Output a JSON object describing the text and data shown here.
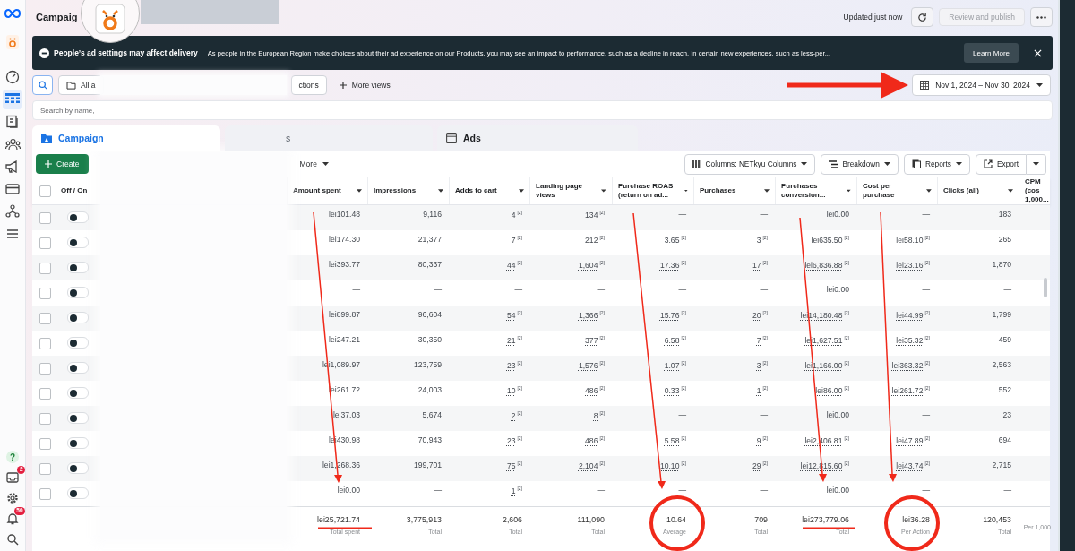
{
  "rail": {
    "items": [
      {
        "kind": "gauge",
        "selected": false
      },
      {
        "kind": "table",
        "selected": true
      },
      {
        "kind": "document",
        "selected": false
      },
      {
        "kind": "people",
        "selected": false
      },
      {
        "kind": "megaphone",
        "selected": false
      },
      {
        "kind": "card",
        "selected": false
      },
      {
        "kind": "network",
        "selected": false
      },
      {
        "kind": "menu",
        "selected": false
      }
    ],
    "bottom": [
      {
        "kind": "help",
        "glyph": "?"
      },
      {
        "kind": "inbox",
        "badge": "2"
      },
      {
        "kind": "gear"
      },
      {
        "kind": "bell",
        "badge": "50"
      },
      {
        "kind": "search"
      }
    ]
  },
  "header": {
    "title": "Campaig",
    "updated": "Updated just now",
    "publish": {
      "label": "Review and publish",
      "disabled": true
    }
  },
  "banner": {
    "title": "People’s ad settings may affect delivery",
    "text": "As people in the European Region make choices about their ad experience on our Products, you may see an impact to performance, such as a decline in reach. In certain new experiences, such as less-per...",
    "button": "Learn More"
  },
  "toolbar": {
    "folder": "All a",
    "collections": "ctions",
    "more_views": "More views",
    "date_range": "Nov 1, 2024 – Nov 30, 2024"
  },
  "search": {
    "placeholder": "Search by name,"
  },
  "tabs": [
    {
      "label": "Campaign",
      "selected": true
    },
    {
      "label": "s",
      "selected": false
    },
    {
      "label": "Ads",
      "selected": false
    }
  ],
  "actions": {
    "create": "Create",
    "more": "More",
    "columns": "Columns: NETkyu Columns",
    "breakdown": "Breakdown",
    "reports": "Reports",
    "export": "Export"
  },
  "table": {
    "all_checked": false,
    "onoff": "Off / On",
    "columns": [
      "Amount spent",
      "Impressions",
      "Adds to cart",
      "Landing page views",
      "Purchase ROAS (return on ad...",
      "Purchases",
      "Purchases conversion...",
      "Cost per purchase",
      "Clicks (all)",
      "CPM (cos 1,000..."
    ],
    "rows": [
      {
        "checked": false,
        "on": false,
        "cells": [
          "lei101.48",
          "9,116",
          {
            "text": "4",
            "note": "[2]"
          },
          {
            "text": "134",
            "note": "[2]"
          },
          "—",
          "—",
          "lei0.00",
          "—",
          "183"
        ]
      },
      {
        "checked": false,
        "on": false,
        "cells": [
          "lei174.30",
          "21,377",
          {
            "text": "7",
            "note": "[2]"
          },
          {
            "text": "212",
            "note": "[2]"
          },
          {
            "text": "3.65",
            "note": "[2]"
          },
          {
            "text": "3",
            "note": "[2]"
          },
          {
            "text": "lei635.50",
            "note": "[2]"
          },
          {
            "text": "lei58.10",
            "note": "[2]"
          },
          "265"
        ]
      },
      {
        "checked": false,
        "on": false,
        "cells": [
          "lei393.77",
          "80,337",
          {
            "text": "44",
            "note": "[2]"
          },
          {
            "text": "1,604",
            "note": "[2]"
          },
          {
            "text": "17.36",
            "note": "[2]"
          },
          {
            "text": "17",
            "note": "[2]"
          },
          {
            "text": "lei6,836.88",
            "note": "[2]"
          },
          {
            "text": "lei23.16",
            "note": "[2]"
          },
          "1,870"
        ]
      },
      {
        "checked": false,
        "on": false,
        "cells": [
          "—",
          "—",
          "—",
          "—",
          "—",
          "—",
          "lei0.00",
          "—",
          "—"
        ]
      },
      {
        "checked": false,
        "on": false,
        "cells": [
          "lei899.87",
          "96,604",
          {
            "text": "54",
            "note": "[2]"
          },
          {
            "text": "1,366",
            "note": "[2]"
          },
          {
            "text": "15.76",
            "note": "[2]"
          },
          {
            "text": "20",
            "note": "[2]"
          },
          {
            "text": "lei14,180.48",
            "note": "[2]"
          },
          {
            "text": "lei44.99",
            "note": "[2]"
          },
          "1,799"
        ]
      },
      {
        "checked": false,
        "on": false,
        "cells": [
          "lei247.21",
          "30,350",
          {
            "text": "21",
            "note": "[2]"
          },
          {
            "text": "377",
            "note": "[2]"
          },
          {
            "text": "6.58",
            "note": "[2]"
          },
          {
            "text": "7",
            "note": "[2]"
          },
          {
            "text": "lei1,627.51",
            "note": "[2]"
          },
          {
            "text": "lei35.32",
            "note": "[2]"
          },
          "459"
        ]
      },
      {
        "checked": false,
        "on": false,
        "cells": [
          "lei1,089.97",
          "123,759",
          {
            "text": "23",
            "note": "[2]"
          },
          {
            "text": "1,576",
            "note": "[2]"
          },
          {
            "text": "1.07",
            "note": "[2]"
          },
          {
            "text": "3",
            "note": "[2]"
          },
          {
            "text": "lei1,166.00",
            "note": "[2]"
          },
          {
            "text": "lei363.32",
            "note": "[2]"
          },
          "2,563"
        ]
      },
      {
        "checked": false,
        "on": false,
        "cells": [
          "lei261.72",
          "24,003",
          {
            "text": "10",
            "note": "[2]"
          },
          {
            "text": "486",
            "note": "[2]"
          },
          {
            "text": "0.33",
            "note": "[2]"
          },
          {
            "text": "1",
            "note": "[2]"
          },
          {
            "text": "lei86.00",
            "note": "[2]"
          },
          {
            "text": "lei261.72",
            "note": "[2]"
          },
          "552"
        ]
      },
      {
        "checked": false,
        "on": false,
        "cells": [
          "lei37.03",
          "5,674",
          {
            "text": "2",
            "note": "[2]"
          },
          {
            "text": "8",
            "note": "[2]"
          },
          "—",
          "—",
          "lei0.00",
          "—",
          "23"
        ]
      },
      {
        "checked": false,
        "on": false,
        "cells": [
          "lei430.98",
          "70,943",
          {
            "text": "23",
            "note": "[2]"
          },
          {
            "text": "486",
            "note": "[2]"
          },
          {
            "text": "5.58",
            "note": "[2]"
          },
          {
            "text": "9",
            "note": "[2]"
          },
          {
            "text": "lei2,406.81",
            "note": "[2]"
          },
          {
            "text": "lei47.89",
            "note": "[2]"
          },
          "694"
        ]
      },
      {
        "checked": false,
        "on": false,
        "cells": [
          "lei1,268.36",
          "199,701",
          {
            "text": "75",
            "note": "[2]"
          },
          {
            "text": "2,104",
            "note": "[2]"
          },
          {
            "text": "10.10",
            "note": "[2]"
          },
          {
            "text": "29",
            "note": "[2]"
          },
          {
            "text": "lei12,815.60",
            "note": "[2]"
          },
          {
            "text": "lei43.74",
            "note": "[2]"
          },
          "2,715"
        ]
      },
      {
        "checked": false,
        "on": false,
        "cells": [
          "lei0.00",
          "—",
          {
            "text": "1",
            "note": "[2]"
          },
          "—",
          "—",
          "—",
          "lei0.00",
          "—",
          "—"
        ]
      }
    ],
    "totals": [
      {
        "value": "lei25,721.74",
        "label": "Total spent"
      },
      {
        "value": "3,775,913",
        "label": "Total"
      },
      {
        "value": "2,606",
        "label": "Total"
      },
      {
        "value": "111,090",
        "label": "Total"
      },
      {
        "value": "10.64",
        "label": "Average"
      },
      {
        "value": "709",
        "label": "Total"
      },
      {
        "value": "lei273,779.06",
        "label": "Total"
      },
      {
        "value": "lei36.28",
        "label": "Per Action"
      },
      {
        "value": "120,453",
        "label": "Total"
      },
      {
        "label": "Per 1,000"
      }
    ]
  }
}
